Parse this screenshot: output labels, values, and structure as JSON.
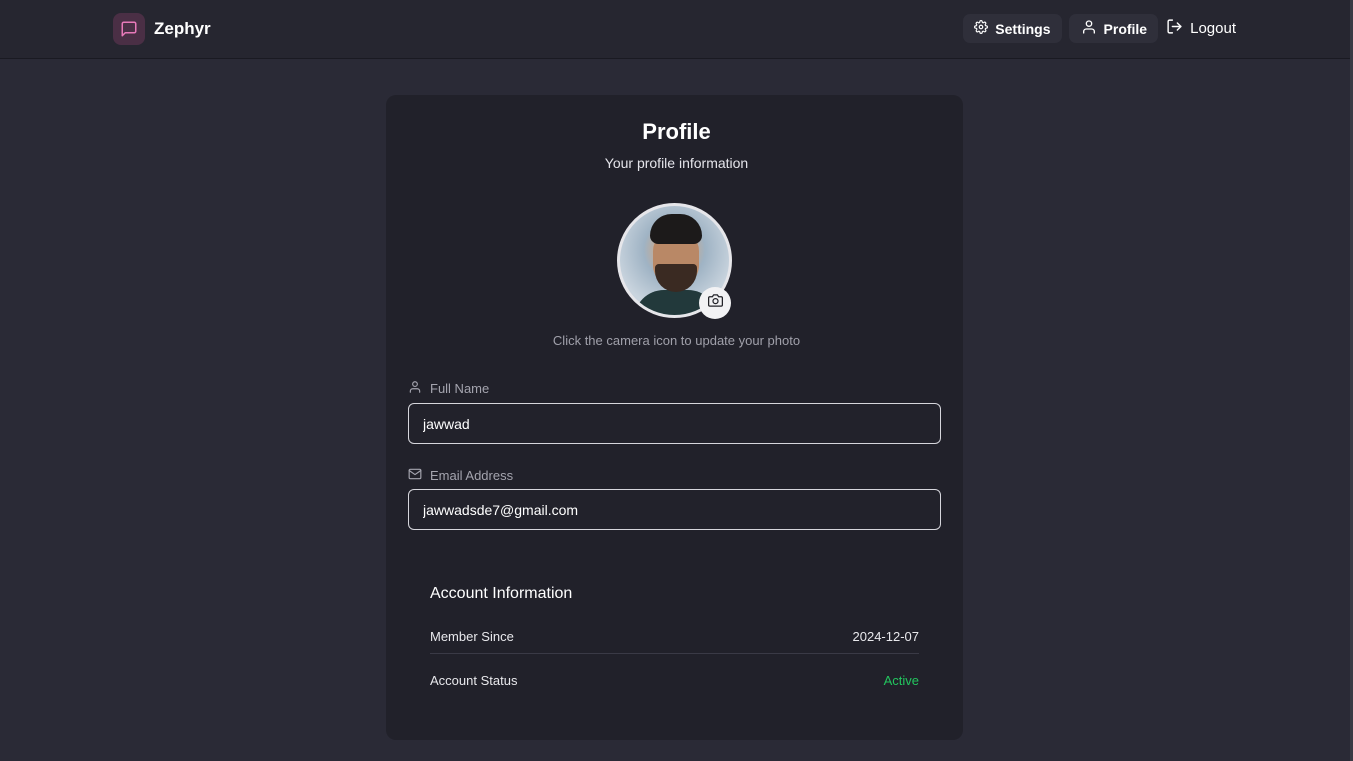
{
  "nav": {
    "brand": "Zephyr",
    "settings_label": "Settings",
    "profile_label": "Profile",
    "logout_label": "Logout"
  },
  "profile": {
    "title": "Profile",
    "subtitle": "Your profile information",
    "photo_hint": "Click the camera icon to update your photo"
  },
  "fields": {
    "full_name_label": "Full Name",
    "full_name_value": "jawwad",
    "email_label": "Email Address",
    "email_value": "jawwadsde7@gmail.com"
  },
  "account": {
    "section_title": "Account Information",
    "member_since_label": "Member Since",
    "member_since_value": "2024-12-07",
    "status_label": "Account Status",
    "status_value": "Active"
  },
  "colors": {
    "background": "#2a2a36",
    "card": "#21212a",
    "brand_accent": "#e879b9",
    "status_active": "#22c55e"
  },
  "icons": [
    "message-square-icon",
    "gear-icon",
    "user-icon",
    "logout-icon",
    "camera-icon",
    "mail-icon"
  ]
}
